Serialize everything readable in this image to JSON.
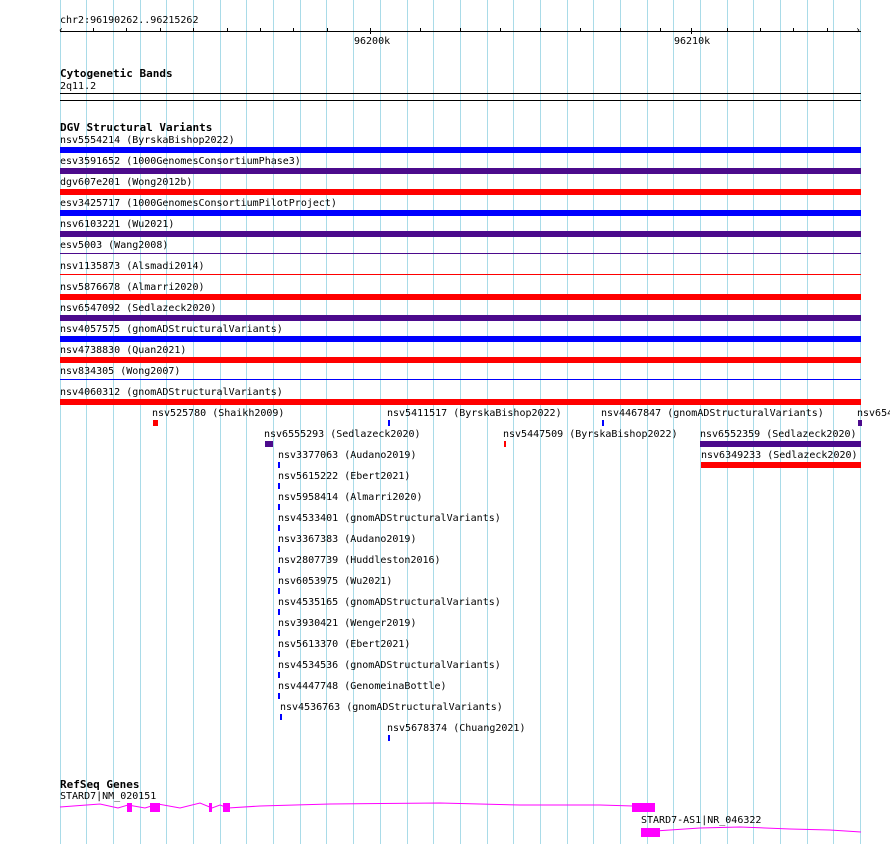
{
  "ruler": {
    "range": "chr2:96190262..96215262",
    "ticks": [
      "96200k",
      "96210k"
    ]
  },
  "cytobands": {
    "title": "Cytogenetic Bands",
    "band": "2q11.2"
  },
  "dgv": {
    "title": "DGV Structural Variants",
    "rows": [
      {
        "label": "nsv5554214 (ByrskaBishop2022)",
        "color": "#0000ff"
      },
      {
        "label": "esv3591652 (1000GenomesConsortiumPhase3)",
        "color": "#4b0a8c"
      },
      {
        "label": "dgv607e201 (Wong2012b)",
        "color": "#ff0000"
      },
      {
        "label": "esv3425717 (1000GenomesConsortiumPilotProject)",
        "color": "#0000ff"
      },
      {
        "label": "nsv6103221 (Wu2021)",
        "color": "#4b0a8c"
      },
      {
        "label": "esv5003 (Wang2008)",
        "color": "#4b0a8c"
      },
      {
        "label": "nsv1135873 (Alsmadi2014)",
        "color": "#ff0000"
      },
      {
        "label": "nsv5876678 (Almarri2020)",
        "color": "#ff0000"
      },
      {
        "label": "nsv6547092 (Sedlazeck2020)",
        "color": "#4b0a8c"
      },
      {
        "label": "nsv4057575 (gnomADStructuralVariants)",
        "color": "#0000ff"
      },
      {
        "label": "nsv4738830 (Quan2021)",
        "color": "#ff0000"
      },
      {
        "label": "nsv834305 (Wong2007)",
        "color": "#0000ff"
      },
      {
        "label": "nsv4060312 (gnomADStructuralVariants)",
        "color": "#ff0000"
      }
    ],
    "small": [
      {
        "label": "nsv525780 (Shaikh2009)",
        "color": "#ff0000"
      },
      {
        "label": "nsv5411517 (ByrskaBishop2022)",
        "color": "#0000ff"
      },
      {
        "label": "nsv4467847 (gnomADStructuralVariants)",
        "color": "#0000ff"
      },
      {
        "label": "nsv654",
        "color": "#4b0a8c"
      },
      {
        "label": "nsv6555293 (Sedlazeck2020)",
        "color": "#4b0a8c"
      },
      {
        "label": "nsv5447509 (ByrskaBishop2022)",
        "color": "#ff0000"
      },
      {
        "label": "nsv6552359 (Sedlazeck2020)",
        "color": "#4b0a8c"
      },
      {
        "label": "nsv6349233 (Sedlazeck2020)",
        "color": "#ff0000"
      },
      {
        "label": "nsv3377063 (Audano2019)",
        "color": "#0000ff"
      },
      {
        "label": "nsv5615222 (Ebert2021)",
        "color": "#0000ff"
      },
      {
        "label": "nsv5958414 (Almarri2020)",
        "color": "#0000ff"
      },
      {
        "label": "nsv4533401 (gnomADStructuralVariants)",
        "color": "#0000ff"
      },
      {
        "label": "nsv3367383 (Audano2019)",
        "color": "#0000ff"
      },
      {
        "label": "nsv2807739 (Huddleston2016)",
        "color": "#0000ff"
      },
      {
        "label": "nsv6053975 (Wu2021)",
        "color": "#0000ff"
      },
      {
        "label": "nsv4535165 (gnomADStructuralVariants)",
        "color": "#0000ff"
      },
      {
        "label": "nsv3930421 (Wenger2019)",
        "color": "#0000ff"
      },
      {
        "label": "nsv5613370 (Ebert2021)",
        "color": "#0000ff"
      },
      {
        "label": "nsv4534536 (gnomADStructuralVariants)",
        "color": "#0000ff"
      },
      {
        "label": "nsv4447748 (GenomeinaBottle)",
        "color": "#0000ff"
      },
      {
        "label": "nsv4536763 (gnomADStructuralVariants)",
        "color": "#0000ff"
      },
      {
        "label": "nsv5678374 (Chuang2021)",
        "color": "#0000ff"
      }
    ]
  },
  "genes": {
    "title": "RefSeq Genes",
    "items": [
      {
        "label": "STARD7|NM_020151",
        "color": "#ff00ff"
      },
      {
        "label": "STARD7-AS1|NR_046322",
        "color": "#ff00ff"
      }
    ]
  },
  "colors": {
    "grid": "#a9dbe8",
    "gene": "#ff00ff"
  }
}
